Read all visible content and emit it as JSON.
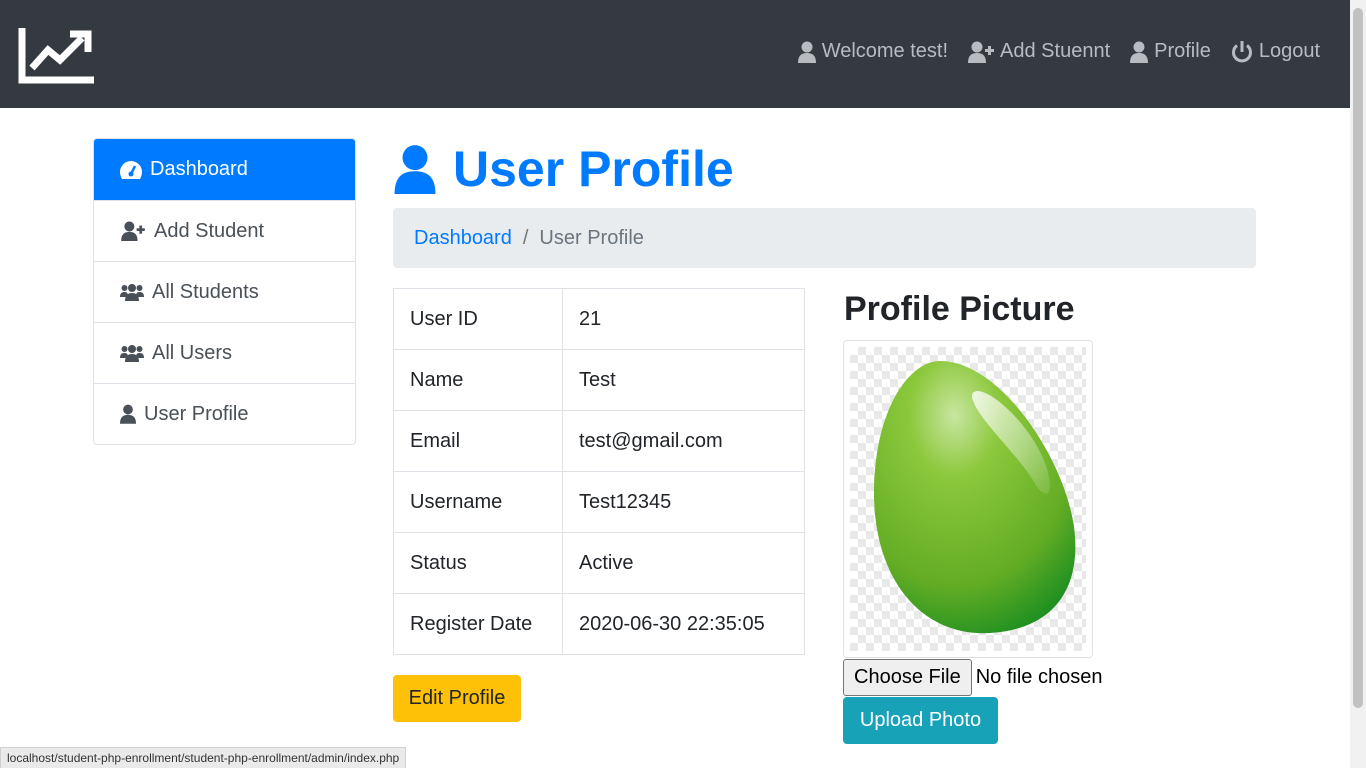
{
  "navbar": {
    "brand_icon": "chart-line-icon",
    "links": [
      {
        "label": "Welcome test!",
        "icon": "user-icon"
      },
      {
        "label": "Add Stuennt",
        "icon": "user-plus-icon"
      },
      {
        "label": "Profile",
        "icon": "user-icon"
      },
      {
        "label": "Logout",
        "icon": "power-icon"
      }
    ]
  },
  "sidebar": {
    "items": [
      {
        "label": "Dashboard",
        "icon": "tachometer-icon",
        "active": true
      },
      {
        "label": "Add Student",
        "icon": "user-plus-icon"
      },
      {
        "label": "All Students",
        "icon": "users-icon"
      },
      {
        "label": "All Users",
        "icon": "users-icon"
      },
      {
        "label": "User Profile",
        "icon": "user-icon"
      }
    ]
  },
  "page": {
    "title": "User Profile",
    "title_icon": "user-icon"
  },
  "breadcrumb": {
    "link": "Dashboard",
    "separator": "/",
    "current": "User Profile"
  },
  "profile_table": {
    "rows": [
      {
        "key": "User ID",
        "value": "21"
      },
      {
        "key": "Name",
        "value": "Test"
      },
      {
        "key": "Email",
        "value": "test@gmail.com"
      },
      {
        "key": "Username",
        "value": "Test12345"
      },
      {
        "key": "Status",
        "value": "Active"
      },
      {
        "key": "Register Date",
        "value": "2020-06-30 22:35:05"
      }
    ]
  },
  "actions": {
    "edit_label": "Edit Profile",
    "choose_file_label": "Choose File",
    "no_file_text": "No file chosen",
    "upload_label": "Upload Photo"
  },
  "profile_picture": {
    "heading": "Profile Picture",
    "image_icon": "green-egg-image"
  },
  "status_bar": {
    "url": "localhost/student-php-enrollment/student-php-enrollment/admin/index.php"
  },
  "colors": {
    "navbar": "#343a40",
    "primary": "#007bff",
    "warning": "#ffc107",
    "info": "#17a2b8"
  }
}
